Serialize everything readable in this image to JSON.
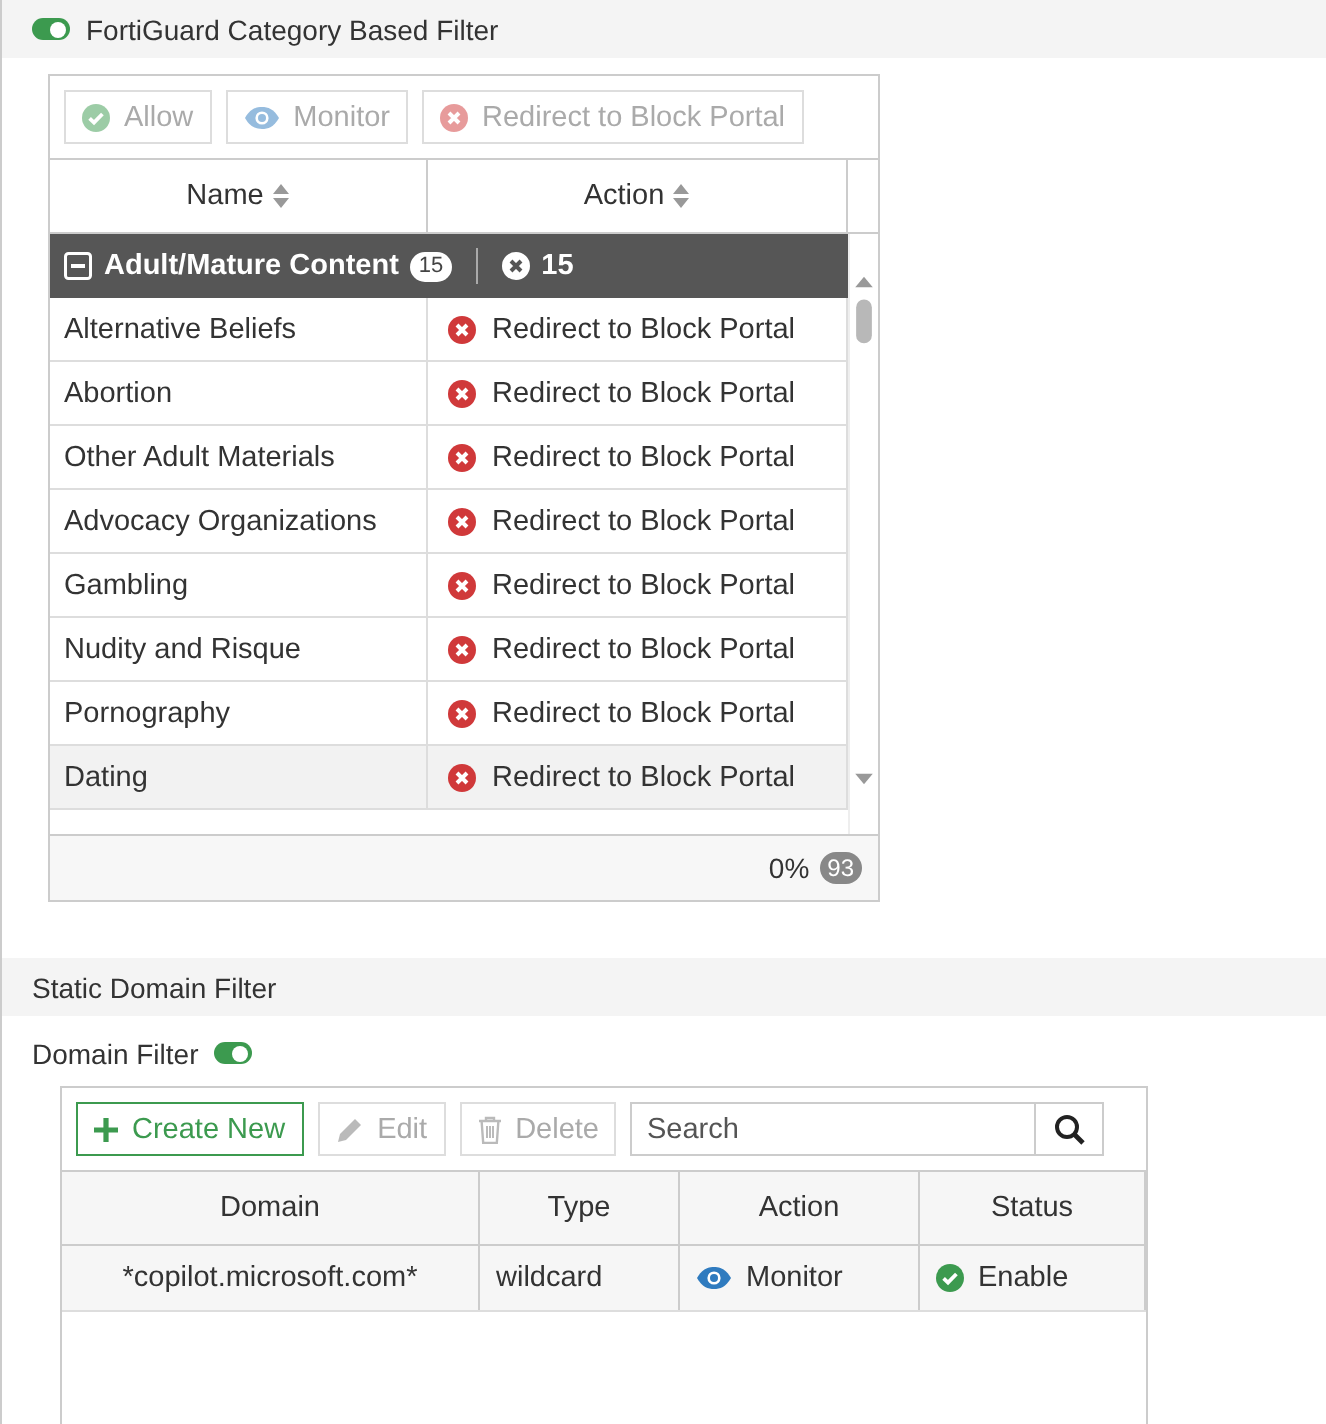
{
  "category_filter": {
    "label": "FortiGuard Category Based Filter",
    "on": true,
    "toolbar": [
      {
        "label": "Allow",
        "kind": "allow",
        "disabled": true
      },
      {
        "label": "Monitor",
        "kind": "monitor",
        "disabled": true
      },
      {
        "label": "Redirect to Block Portal",
        "kind": "block",
        "disabled": true
      }
    ],
    "columns": [
      {
        "label": "Name",
        "sortable": true
      },
      {
        "label": "Action",
        "sortable": true
      }
    ],
    "group": {
      "name": "Adult/Mature Content",
      "count": "15",
      "expanded": true,
      "action": {
        "kind": "block",
        "count": "15"
      }
    },
    "rows": [
      {
        "name": "Alternative Beliefs",
        "action": {
          "label": "Redirect to Block Portal",
          "kind": "block"
        },
        "selected": false
      },
      {
        "name": "Abortion",
        "action": {
          "label": "Redirect to Block Portal",
          "kind": "block"
        },
        "selected": false
      },
      {
        "name": "Other Adult Materials",
        "action": {
          "label": "Redirect to Block Portal",
          "kind": "block"
        },
        "selected": false
      },
      {
        "name": "Advocacy Organizations",
        "action": {
          "label": "Redirect to Block Portal",
          "kind": "block"
        },
        "selected": false
      },
      {
        "name": "Gambling",
        "action": {
          "label": "Redirect to Block Portal",
          "kind": "block"
        },
        "selected": false
      },
      {
        "name": "Nudity and Risque",
        "action": {
          "label": "Redirect to Block Portal",
          "kind": "block"
        },
        "selected": false
      },
      {
        "name": "Pornography",
        "action": {
          "label": "Redirect to Block Portal",
          "kind": "block"
        },
        "selected": false
      },
      {
        "name": "Dating",
        "action": {
          "label": "Redirect to Block Portal",
          "kind": "block"
        },
        "selected": true
      }
    ],
    "footer": {
      "percent": "0%",
      "total": "93"
    }
  },
  "static_domain_filter": {
    "title": "Static Domain Filter",
    "domain_filter": {
      "label": "Domain Filter",
      "on": true
    },
    "toolbar": [
      {
        "label": "Create New",
        "kind": "create",
        "disabled": false
      },
      {
        "label": "Edit",
        "kind": "edit",
        "disabled": true
      },
      {
        "label": "Delete",
        "kind": "delete",
        "disabled": true
      }
    ],
    "search": {
      "placeholder": "Search"
    },
    "columns": [
      "Domain",
      "Type",
      "Action",
      "Status"
    ],
    "rows": [
      {
        "domain": "*copilot.microsoft.com*",
        "type": "wildcard",
        "action": {
          "label": "Monitor",
          "kind": "monitor"
        },
        "status": {
          "label": "Enable",
          "kind": "enable"
        }
      }
    ]
  }
}
